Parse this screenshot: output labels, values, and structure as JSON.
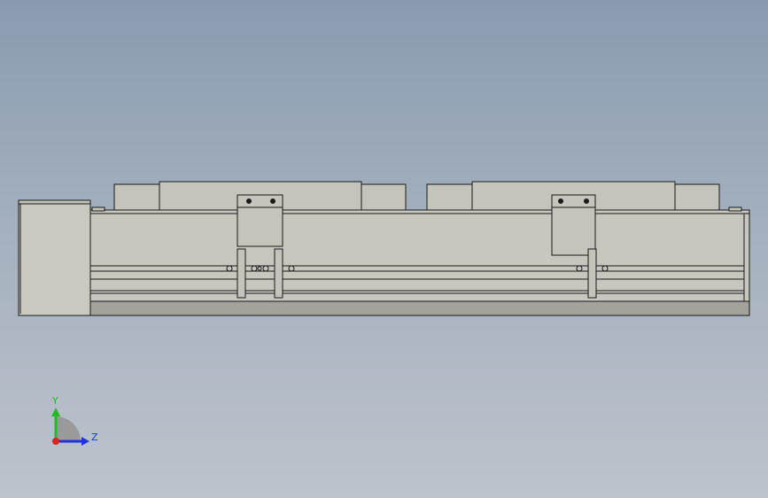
{
  "scene": {
    "view": "side",
    "background_top": "#8a9bb0",
    "background_bottom": "#bcc3cc",
    "part_fill": "#c4c4bb",
    "part_fill_dark": "#9a9a92",
    "edge_color": "#1a1a1a"
  },
  "triad": {
    "y_label": "Y",
    "z_label": "Z",
    "y_color": "#22bb22",
    "z_color": "#2233dd",
    "x_color": "#dd2222"
  }
}
